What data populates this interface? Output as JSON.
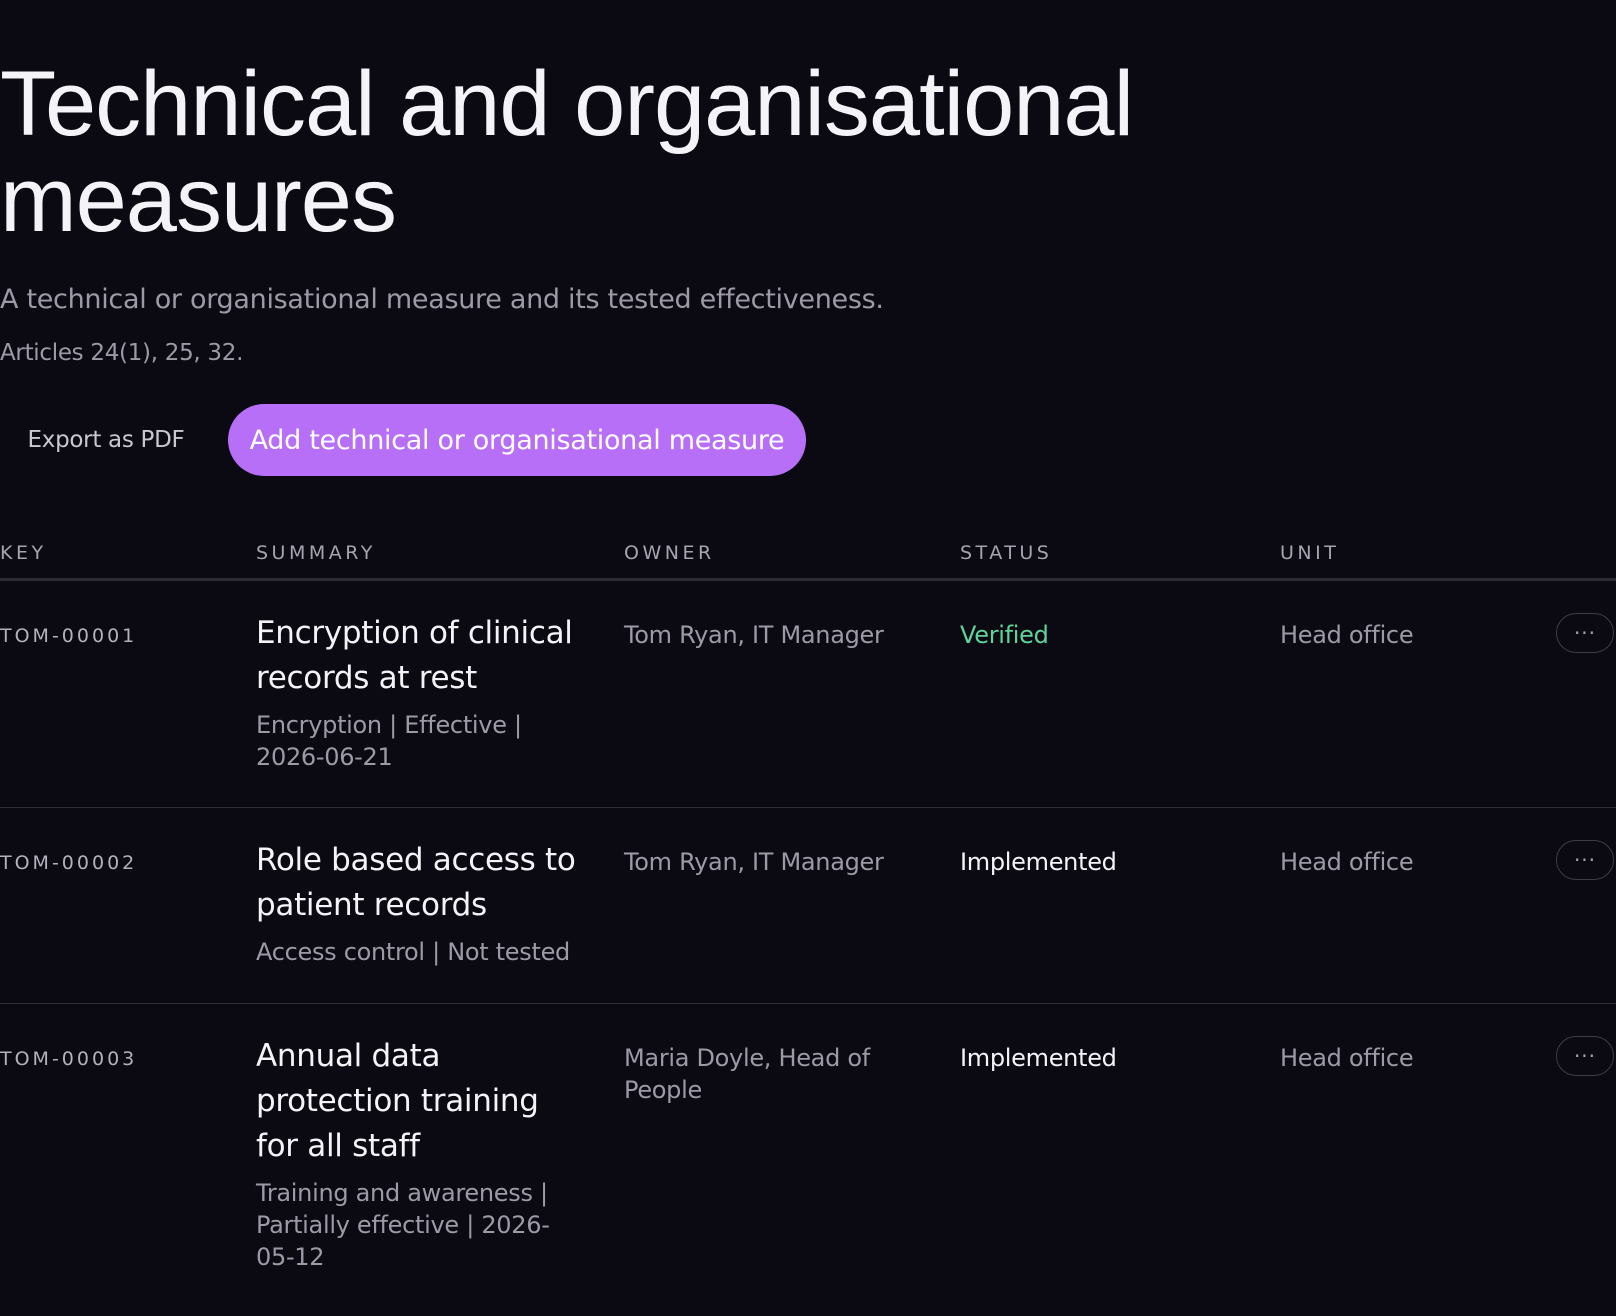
{
  "header": {
    "title": "Technical and organisational measures",
    "subtitle": "A technical or organisational measure and its tested effectiveness.",
    "articles": "Articles 24(1), 25, 32."
  },
  "actions": {
    "export_label": "Export as PDF",
    "add_label": "Add technical or organisational measure"
  },
  "table": {
    "columns": {
      "key": "KEY",
      "summary": "SUMMARY",
      "owner": "OWNER",
      "status": "STATUS",
      "unit": "UNIT"
    },
    "rows": [
      {
        "key": "TOM-00001",
        "title": "Encryption of clinical records at rest",
        "meta": "Encryption | Effective | 2026-06-21",
        "owner": "Tom Ryan, IT Manager",
        "status": "Verified",
        "unit": "Head office",
        "more": "···"
      },
      {
        "key": "TOM-00002",
        "title": "Role based access to patient records",
        "meta": "Access control | Not tested",
        "owner": "Tom Ryan, IT Manager",
        "status": "Implemented",
        "unit": "Head office",
        "more": "···"
      },
      {
        "key": "TOM-00003",
        "title": "Annual data protection training for all staff",
        "meta": "Training and awareness | Partially effective | 2026-05-12",
        "owner": "Maria Doyle, Head of People",
        "status": "Implemented",
        "unit": "Head office",
        "more": "···"
      }
    ]
  },
  "colors": {
    "background": "#0b0a12",
    "accent": "#b86ff7",
    "verified": "#5fd39a"
  }
}
